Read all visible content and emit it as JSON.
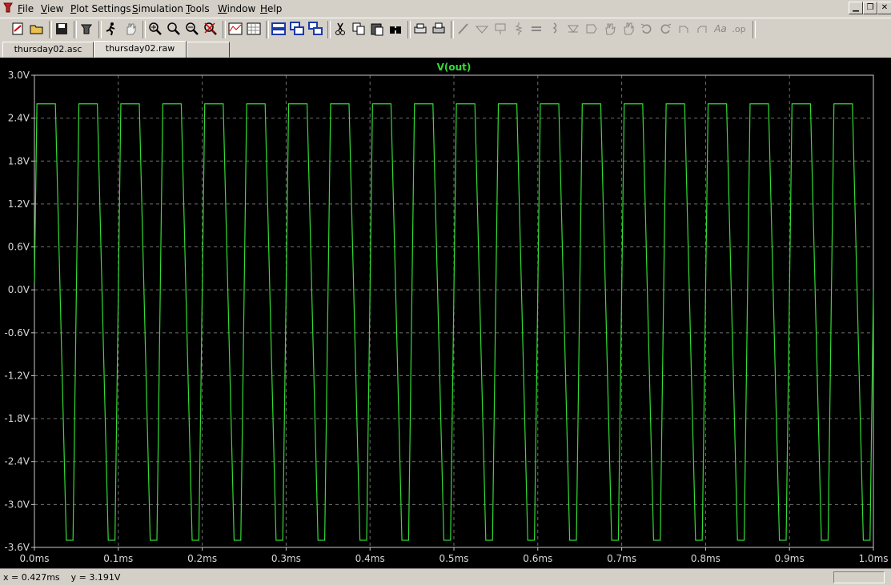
{
  "menu": {
    "items": [
      "File",
      "View",
      "Plot Settings",
      "Simulation",
      "Tools",
      "Window",
      "Help"
    ]
  },
  "toolbar": {
    "icons": [
      "new-schematic-icon",
      "open-icon",
      "save-icon",
      "control-panel-icon",
      "run-icon",
      "halt-icon",
      "zoom-in-icon",
      "zoom-area-icon",
      "zoom-out-icon",
      "zoom-cancel-icon",
      "autorange-icon",
      "grid-icon",
      "tile-horizontal-icon",
      "cascade-icon",
      "tile-vertical-icon",
      "cut-icon",
      "copy-icon",
      "paste-icon",
      "find-icon",
      "print-preview-icon",
      "print-icon",
      "wire-icon",
      "ground-icon",
      "label-net-icon",
      "resistor-icon",
      "capacitor-icon",
      "inductor-icon",
      "diode-icon",
      "component-icon",
      "move-icon",
      "drag-icon",
      "undo-icon",
      "redo-icon",
      "rotate-icon",
      "mirror-icon",
      "text-icon",
      "spice-directive-icon"
    ]
  },
  "tabs": [
    {
      "label": "thursday02.asc"
    },
    {
      "label": "thursday02.raw"
    },
    {
      "label": ""
    }
  ],
  "status": {
    "cursor": "x = 0.427ms    y = 3.191V"
  },
  "colors": {
    "trace": "#33dd33",
    "grid": "#6e6e6e",
    "background": "#000000",
    "axis_text": "#d8d8d8"
  },
  "chart_data": {
    "type": "line",
    "title": "V(out)",
    "xlabel": "",
    "ylabel": "",
    "xlim": [
      0.0,
      1.0
    ],
    "ylim": [
      -3.6,
      3.0
    ],
    "x_ticks": [
      "0.0ms",
      "0.1ms",
      "0.2ms",
      "0.3ms",
      "0.4ms",
      "0.5ms",
      "0.6ms",
      "0.7ms",
      "0.8ms",
      "0.9ms",
      "1.0ms"
    ],
    "y_ticks": [
      "3.0V",
      "2.4V",
      "1.8V",
      "1.2V",
      "0.6V",
      "0.0V",
      "-0.6V",
      "-1.2V",
      "-1.8V",
      "-2.4V",
      "-3.0V",
      "-3.6V"
    ],
    "y_tick_values": [
      3.0,
      2.4,
      1.8,
      1.2,
      0.6,
      0.0,
      -0.6,
      -1.2,
      -1.8,
      -2.4,
      -3.0,
      -3.6
    ],
    "grid": true,
    "series": [
      {
        "name": "V(out)",
        "wave": {
          "start_value": 0.1,
          "high": 2.6,
          "low": -3.5,
          "period_ms": 0.05,
          "first_rise_start_ms": 0.0,
          "first_high_ms": 0.003,
          "high_duration_ms": 0.022,
          "fall_duration_ms": 0.013,
          "low_duration_ms": 0.008,
          "rise_duration_ms": 0.007,
          "end_ms": 1.0
        }
      }
    ]
  }
}
